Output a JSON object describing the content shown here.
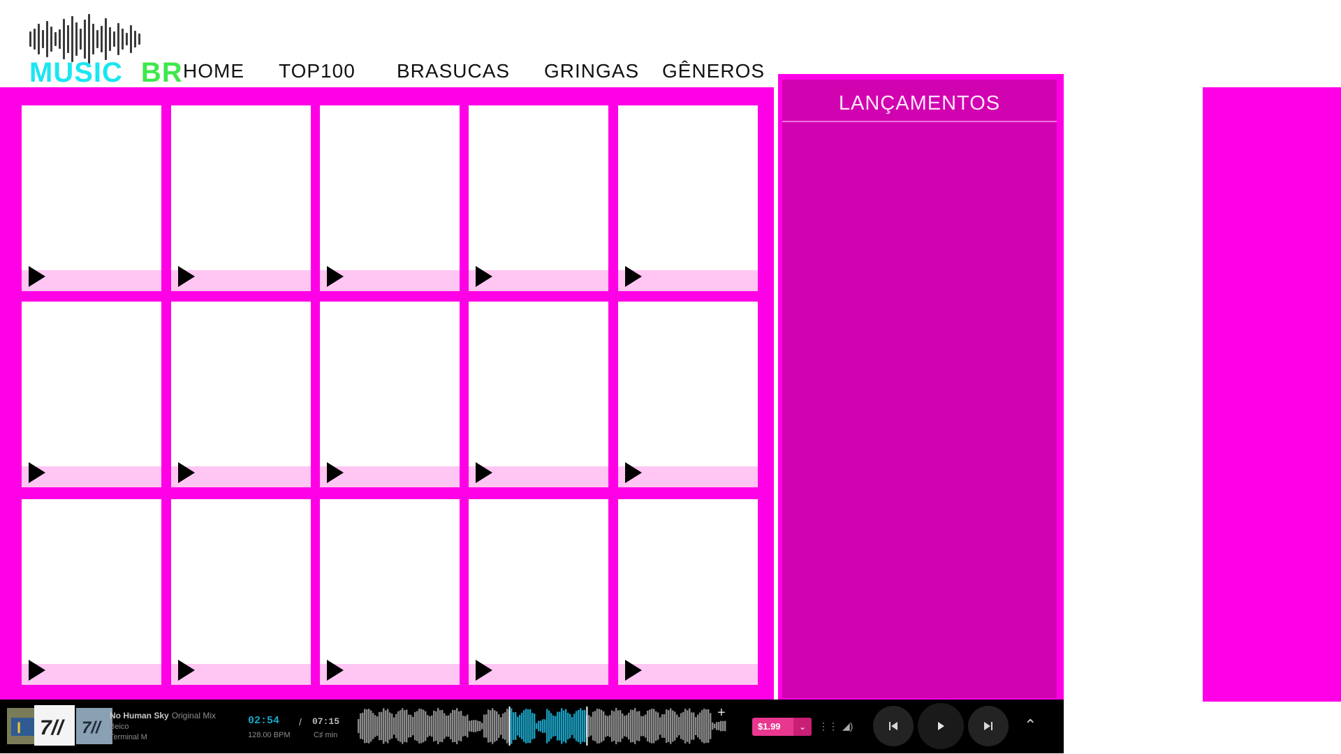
{
  "logo": {
    "music": "MUSIC",
    "br": "BR"
  },
  "nav": [
    {
      "label": "HOME"
    },
    {
      "label": "TOP100"
    },
    {
      "label": "BRASUCAS"
    },
    {
      "label": "GRINGAS"
    },
    {
      "label": "GÊNEROS"
    }
  ],
  "sidebar": {
    "title": "LANÇAMENTOS"
  },
  "player": {
    "track_title": "No Human Sky",
    "track_mix": "Original Mix",
    "artist": "Beico",
    "label": "Terminal M",
    "time_current": "02:54",
    "time_separator": "/",
    "time_total": "07:15",
    "bpm": "128.00 BPM",
    "key": "C♯ min",
    "price": "$1.99",
    "add_symbol": "+",
    "progress": 0.4
  },
  "colors": {
    "accent_pink": "#ff00e6",
    "panel_magenta": "#d102b0",
    "card_bar": "#ffc6f3",
    "wave_played": "#1a9dbf",
    "price_button": "#e9378f"
  },
  "icons": {
    "card_play": "play-triangle-icon",
    "player": [
      "previous-icon",
      "play-icon",
      "next-icon",
      "queue-icon",
      "volume-icon",
      "chevron-up-icon",
      "plus-icon",
      "chevron-down-icon"
    ]
  }
}
